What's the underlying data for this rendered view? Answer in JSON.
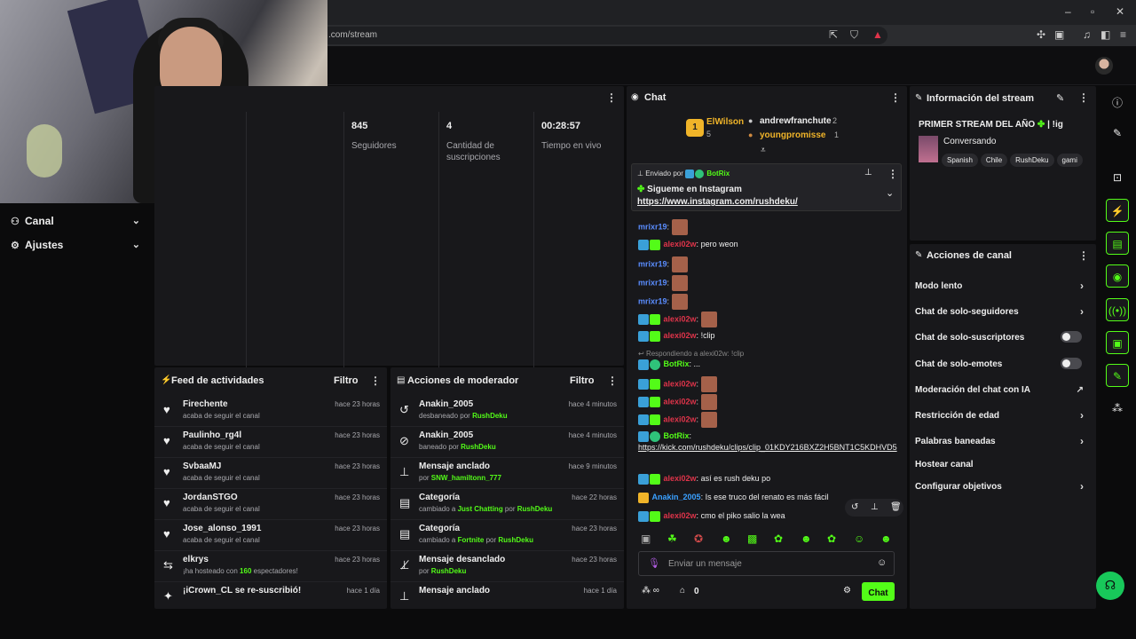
{
  "browser": {
    "url": ".com/stream",
    "window_controls": [
      "minimize-icon",
      "maximize-icon",
      "close-icon"
    ]
  },
  "sidebar": {
    "items": [
      {
        "label": "Canal",
        "icon": "people-icon"
      },
      {
        "label": "Ajustes",
        "icon": "gear-icon"
      }
    ]
  },
  "stats": {
    "items": [
      {
        "value": "845",
        "label": "Seguidores"
      },
      {
        "value": "4",
        "label": "Cantidad de suscripciones"
      },
      {
        "value": "00:28:57",
        "label": "Tiempo en vivo"
      }
    ]
  },
  "feed": {
    "title": "Feed de actividades",
    "filter": "Filtro",
    "rows": [
      {
        "name": "Firechente",
        "sub": "acaba de seguir el canal",
        "time": "hace 23 horas",
        "icon": "heart-icon"
      },
      {
        "name": "Paulinho_rg4l",
        "sub": "acaba de seguir el canal",
        "time": "hace 23 horas",
        "icon": "heart-icon"
      },
      {
        "name": "SvbaaMJ",
        "sub": "acaba de seguir el canal",
        "time": "hace 23 horas",
        "icon": "heart-icon"
      },
      {
        "name": "JordanSTGO",
        "sub": "acaba de seguir el canal",
        "time": "hace 23 horas",
        "icon": "heart-icon"
      },
      {
        "name": "Jose_alonso_1991",
        "sub": "acaba de seguir el canal",
        "time": "hace 23 horas",
        "icon": "heart-icon"
      },
      {
        "name": "elkrys",
        "sub_pre": "¡ha hosteado con ",
        "sub_hl": "160",
        "sub_post": " espectadores!",
        "time": "hace 23 horas",
        "icon": "host-icon"
      },
      {
        "name": "¡iCrown_CL se re-suscribió!",
        "sub": "",
        "time": "hace 1 día",
        "icon": "sparkle-icon"
      }
    ]
  },
  "mod": {
    "title": "Acciones de moderador",
    "filter": "Filtro",
    "rows": [
      {
        "name": "Anakin_2005",
        "sub": "desbaneado por ",
        "hl": "RushDeku",
        "time": "hace 4 minutos",
        "icon": "undo-icon"
      },
      {
        "name": "Anakin_2005",
        "sub": "baneado por ",
        "hl": "RushDeku",
        "time": "hace 4 minutos",
        "icon": "ban-icon"
      },
      {
        "name": "Mensaje anclado",
        "sub": "por ",
        "hl": "SNW_hamiltonn_777",
        "time": "hace 9 minutos",
        "icon": "pin-icon"
      },
      {
        "name": "Categoría",
        "sub": "cambiado a ",
        "hl": "Just Chatting",
        "sub2": " por ",
        "hl2": "RushDeku",
        "time": "hace 22 horas",
        "icon": "category-icon"
      },
      {
        "name": "Categoría",
        "sub": "cambiado a ",
        "hl": "Fortnite",
        "sub2": " por ",
        "hl2": "RushDeku",
        "time": "hace 23 horas",
        "icon": "category-icon"
      },
      {
        "name": "Mensaje desanclado",
        "sub": "por ",
        "hl": "RushDeku",
        "time": "hace 23 horas",
        "icon": "unpin-icon"
      },
      {
        "name": "Mensaje anclado",
        "sub": "",
        "hl": "",
        "time": "hace 1 día",
        "icon": "pin-icon"
      }
    ]
  },
  "chat": {
    "title": "Chat",
    "leaderboard": {
      "first_name": "ElWilson",
      "first_rank": "1",
      "first_count": "5",
      "second_name": "andrewfranchute",
      "second_count": "2",
      "third_name": "youngpromisse",
      "third_count": "1"
    },
    "pinned": {
      "header": "Enviado por",
      "by": "BotRix",
      "title": "Sigueme en Instagram",
      "link": "https://www.instagram.com/rushdeku/"
    },
    "messages": [
      {
        "user": "mrixr19",
        "color": "blue",
        "text": "",
        "emote": true
      },
      {
        "user": "alexi02w",
        "color": "red",
        "text": "pero weon",
        "badges": true
      },
      {
        "user": "mrixr19",
        "color": "blue",
        "text": "",
        "emote": true
      },
      {
        "user": "mrixr19",
        "color": "blue",
        "text": "",
        "emote": true
      },
      {
        "user": "mrixr19",
        "color": "blue",
        "text": "",
        "emote": true
      },
      {
        "user": "alexi02w",
        "color": "red",
        "text": "",
        "emote": true,
        "badges": true
      },
      {
        "user": "alexi02w",
        "color": "red",
        "text": "!clip",
        "badges": true
      }
    ],
    "reply_to": "Respondiendo a alexi02w: !clip",
    "botrix_msg": "...",
    "more_messages": [
      {
        "user": "alexi02w",
        "color": "red",
        "text": "",
        "emote": true
      },
      {
        "user": "alexi02w",
        "color": "red",
        "text": "",
        "emote": true
      },
      {
        "user": "alexi02w",
        "color": "red",
        "text": "",
        "emote": true
      }
    ],
    "clip_user": "BotRix",
    "clip_link": "https://kick.com/rushdeku/clips/clip_01KDY216BXZ2H5BNT1C5KDHVD5",
    "msg_rush": {
      "user": "alexi02w",
      "text": "así es rush deku po"
    },
    "msg_anakin": {
      "user": "Anakin_2005",
      "text": "Is ese truco del renato es más fácil"
    },
    "msg_last": {
      "user": "alexi02w",
      "text": "cmo el piko salio la wea"
    },
    "input_placeholder": "Enviar un mensaje",
    "points_label": "0",
    "send_label": "Chat"
  },
  "info": {
    "title": "Información del stream",
    "stream_title": "PRIMER STREAM DEL AÑO",
    "stream_suffix": "!ig",
    "category": "Conversando",
    "tags": [
      "Spanish",
      "Chile",
      "RushDeku",
      "gami"
    ]
  },
  "actions": {
    "title": "Acciones de canal",
    "rows": [
      {
        "label": "Modo lento",
        "kind": "chevron"
      },
      {
        "label": "Chat de solo-seguidores",
        "kind": "chevron"
      },
      {
        "label": "Chat de solo-suscriptores",
        "kind": "toggle"
      },
      {
        "label": "Chat de solo-emotes",
        "kind": "toggle"
      },
      {
        "label": "Moderación del chat con IA",
        "kind": "external"
      },
      {
        "label": "Restricción de edad",
        "kind": "chevron"
      },
      {
        "label": "Palabras baneadas",
        "kind": "chevron"
      },
      {
        "label": "Hostear canal",
        "kind": "none"
      },
      {
        "label": "Configurar objetivos",
        "kind": "chevron"
      }
    ]
  },
  "colors": {
    "accent": "#53fc18",
    "panel": "#18181b",
    "bg": "#0b0b0c"
  }
}
